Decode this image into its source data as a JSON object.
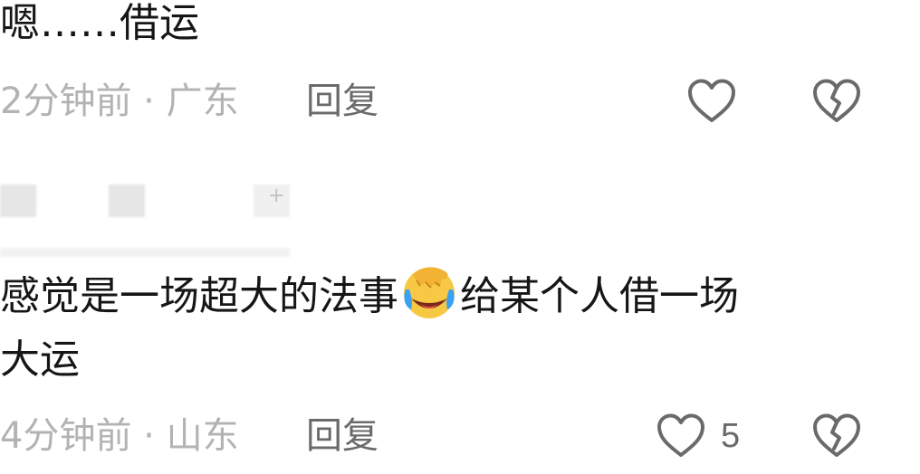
{
  "comments": [
    {
      "text": "嗯……借运",
      "meta": "2分钟前 · 广东",
      "reply_label": "回复",
      "like_count": ""
    },
    {
      "text_part1": "感觉是一场超大的法事",
      "text_part2": "给某个人借一场",
      "text_line2": "大运",
      "meta": "4分钟前 · 山东",
      "reply_label": "回复",
      "like_count": "5",
      "emoji": "facepalm-laughing-crying-emoji"
    }
  ],
  "icons": {
    "like": "heart-outline-icon",
    "dislike": "broken-heart-icon"
  },
  "colors": {
    "text": "#161616",
    "meta": "#b3b3b3",
    "action": "#6a6a6a",
    "emoji_face": "#f7c843",
    "emoji_tears": "#3aa0f0"
  }
}
